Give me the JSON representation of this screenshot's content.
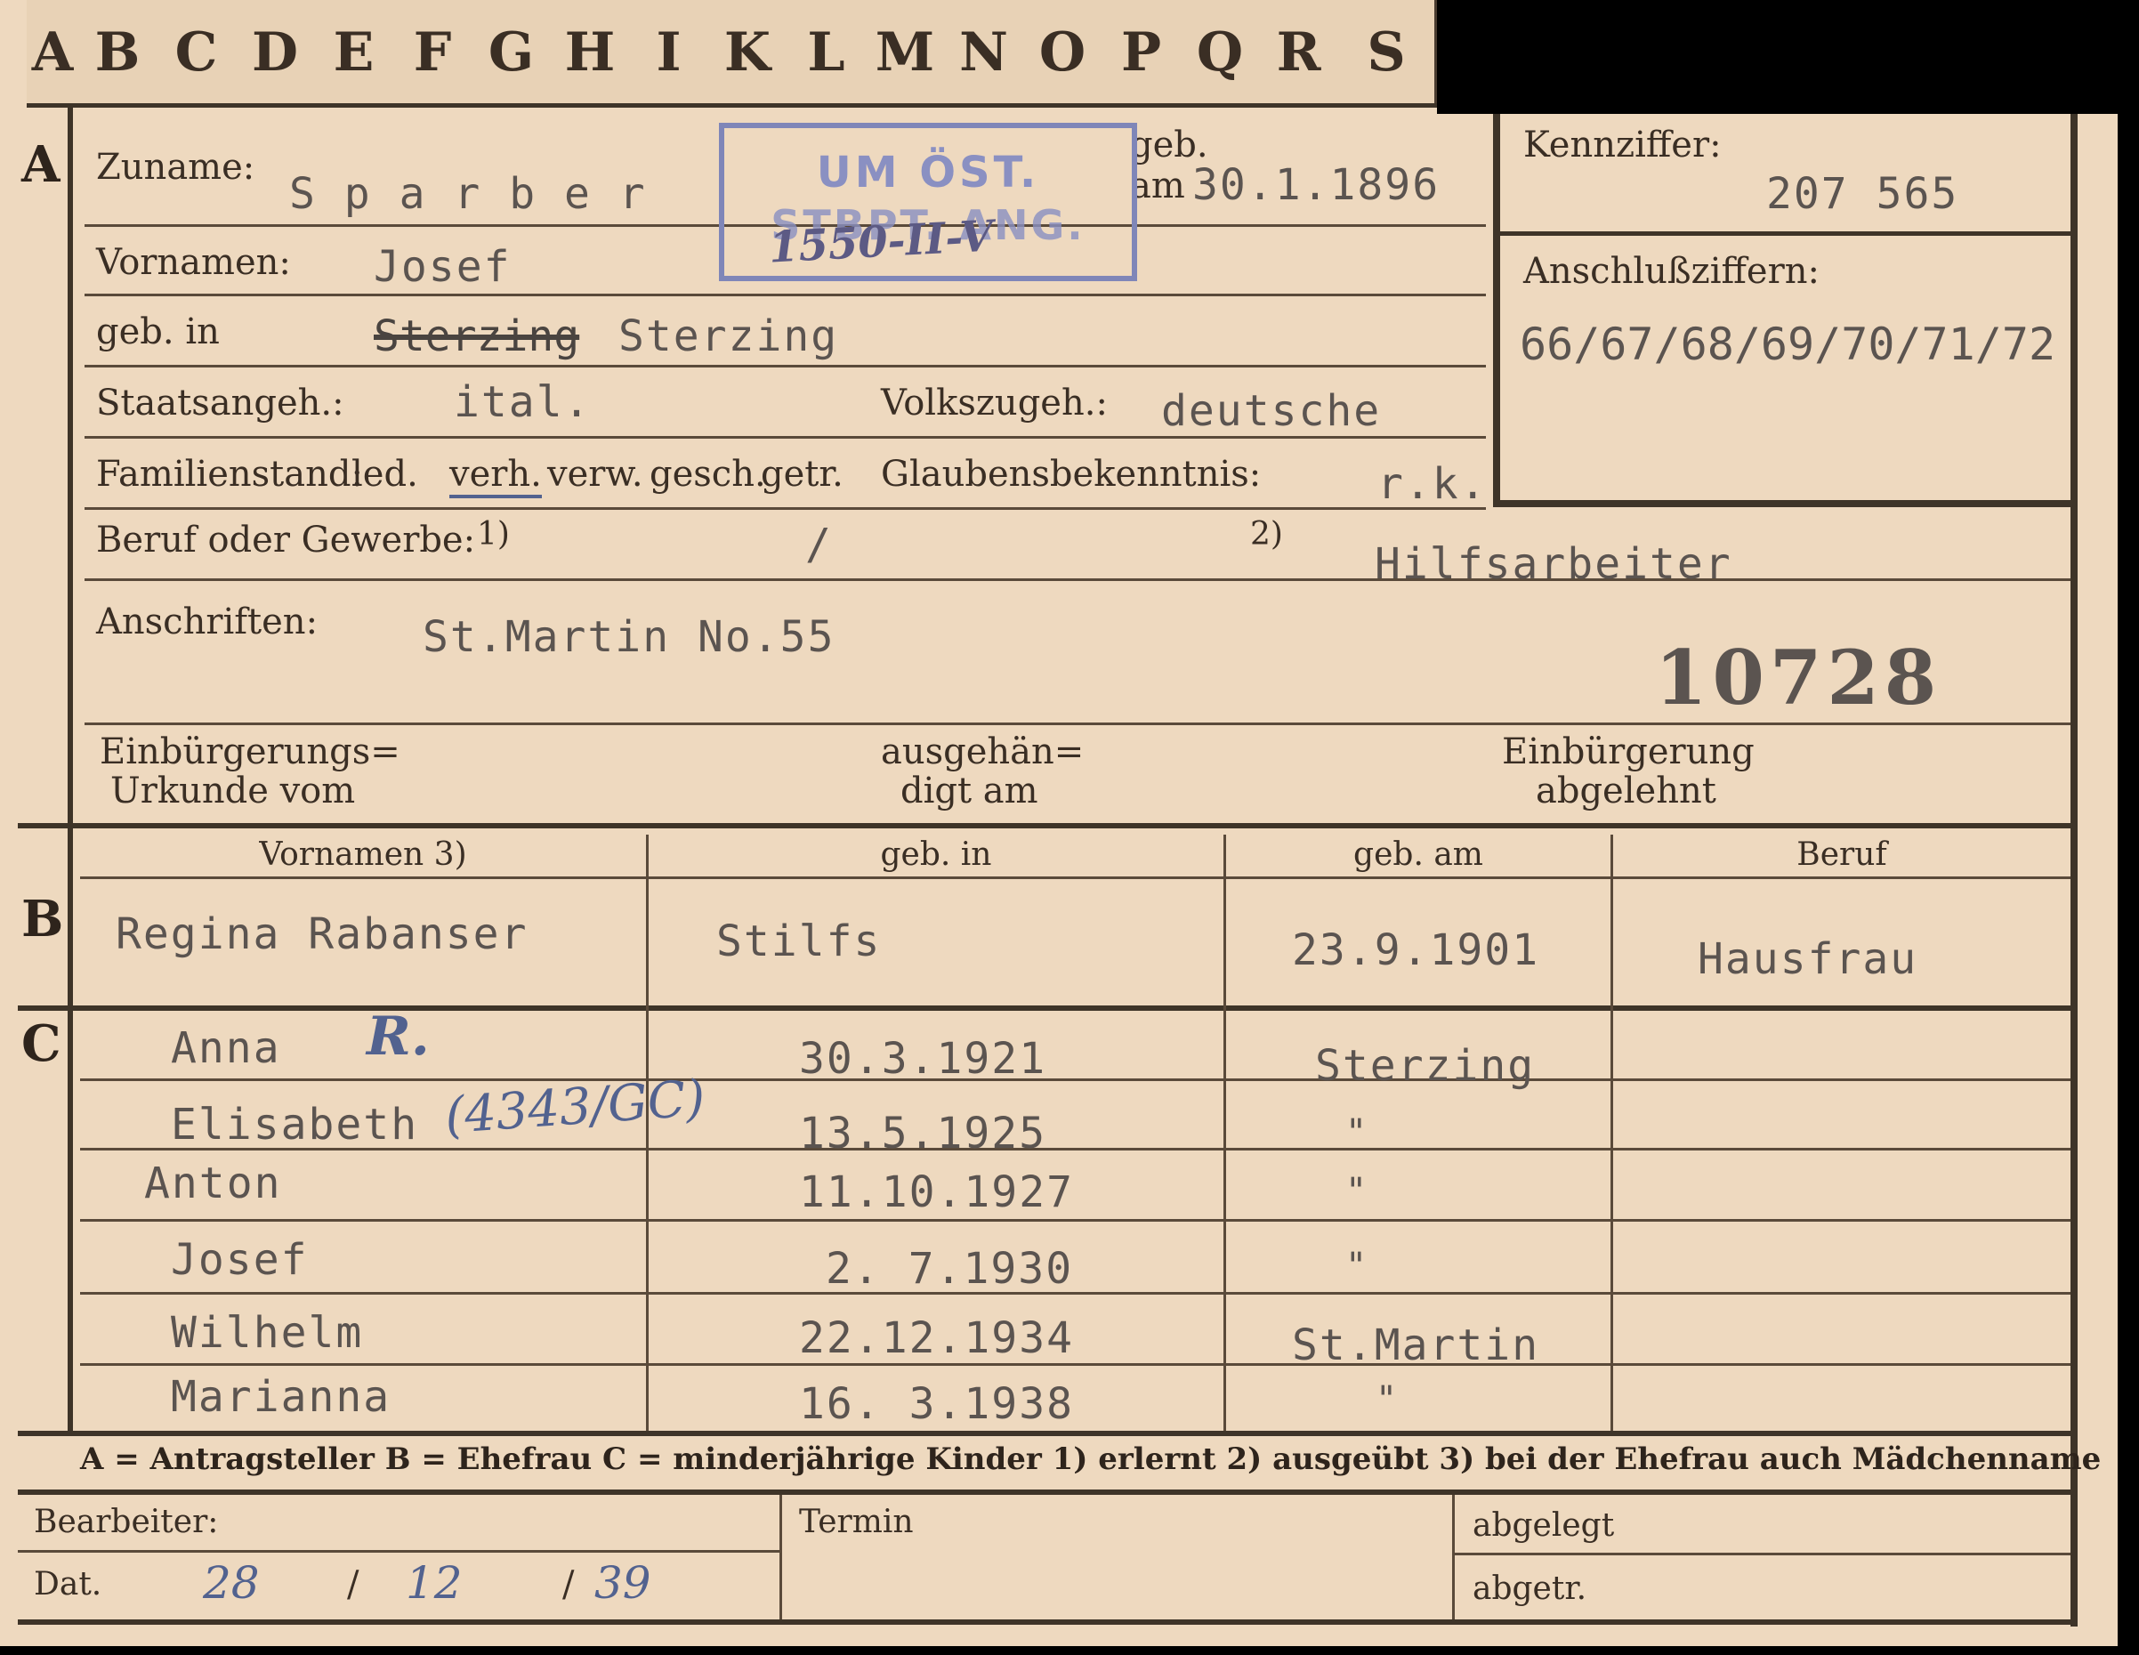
{
  "tabs": [
    "A",
    "B",
    "C",
    "D",
    "E",
    "F",
    "G",
    "H",
    "I",
    "K",
    "L",
    "M",
    "N",
    "O",
    "P",
    "Q",
    "R",
    "S"
  ],
  "sections": {
    "a": "A",
    "b": "B",
    "c": "C"
  },
  "applicant": {
    "zuname_label": "Zuname:",
    "zuname": "S p a r b e r",
    "geb_label": "geb.",
    "am_label": "am",
    "birth_date": "30.1.1896",
    "vornamen_label": "Vornamen:",
    "vornamen": "Josef",
    "geb_in_label": "geb. in",
    "geb_in_struck": "Sterzing",
    "geb_in": "Sterzing",
    "staatsangeh_label": "Staatsangeh.:",
    "staatsangeh": "ital.",
    "volkszugeh_label": "Volkszugeh.:",
    "volkszugeh": "deutsche",
    "familienstand_label": "Familienstand:",
    "familienstand_options": [
      "led.",
      "verh.",
      "verw.",
      "gesch.",
      "getr."
    ],
    "glauben_label": "Glaubensbekenntnis:",
    "glauben": "r.k.",
    "beruf_label": "Beruf oder Gewerbe:",
    "beruf_note1": "1)",
    "beruf_1": "/",
    "beruf_note2": "2)",
    "beruf_2": "Hilfsarbeiter",
    "anschriften_label": "Anschriften:",
    "anschrift": "St.Martin No.55",
    "file_number": "10728",
    "einbuergerung_label_1": "Einbürgerungs=",
    "einbuergerung_label_2": "Urkunde vom",
    "ausgehaendigt_1": "ausgehän=",
    "ausgehaendigt_2": "digt am",
    "abgelehnt_1": "Einbürgerung",
    "abgelehnt_2": "abgelehnt"
  },
  "stamp": {
    "line1": "UM ÖST.",
    "line2": "STBPT. ANG.",
    "handwritten": "1550-II-V"
  },
  "kennziffer": {
    "label": "Kennziffer:",
    "value": "207 565",
    "anschluss_label": "Anschlußziffern:",
    "anschluss_value": "66/67/68/69/70/71/72"
  },
  "spouse": {
    "headers": [
      "Vornamen 3)",
      "geb. in",
      "geb. am",
      "Beruf"
    ],
    "name": "Regina Rabanser",
    "place": "Stilfs",
    "date": "23.9.1901",
    "job": "Hausfrau"
  },
  "children": [
    {
      "name": "Anna",
      "date": "30.3.1921",
      "place": "Sterzing"
    },
    {
      "name": "Elisabeth",
      "date": "13.5.1925",
      "place": "\""
    },
    {
      "name": "Anton",
      "date": "11.10.1927",
      "place": "\""
    },
    {
      "name": "Josef",
      "date": "2. 7.1930",
      "place": "\""
    },
    {
      "name": "Wilhelm",
      "date": "22.12.1934",
      "place": "St.Martin"
    },
    {
      "name": "Marianna",
      "date": "16. 3.1938",
      "place": "\""
    }
  ],
  "child_notes": {
    "anna": "R.",
    "elisabeth": "(4343/GC)"
  },
  "legend": "A = Antragsteller   B = Ehefrau   C = minderjährige Kinder   1) erlernt   2) ausgeübt   3) bei der Ehefrau auch Mädchenname",
  "footer": {
    "bearbeiter_label": "Bearbeiter:",
    "dat_label": "Dat.",
    "dat_day": "28",
    "dat_month": "12",
    "dat_year": "39",
    "termin_label": "Termin",
    "abgelegt_label": "abgelegt",
    "abgetr_label": "abgetr."
  },
  "colors": {
    "card": "#eed9bf",
    "ink_typed": "#5b5450",
    "ink_stamp": "#8a90c2",
    "ink_pen": "#52628f"
  }
}
